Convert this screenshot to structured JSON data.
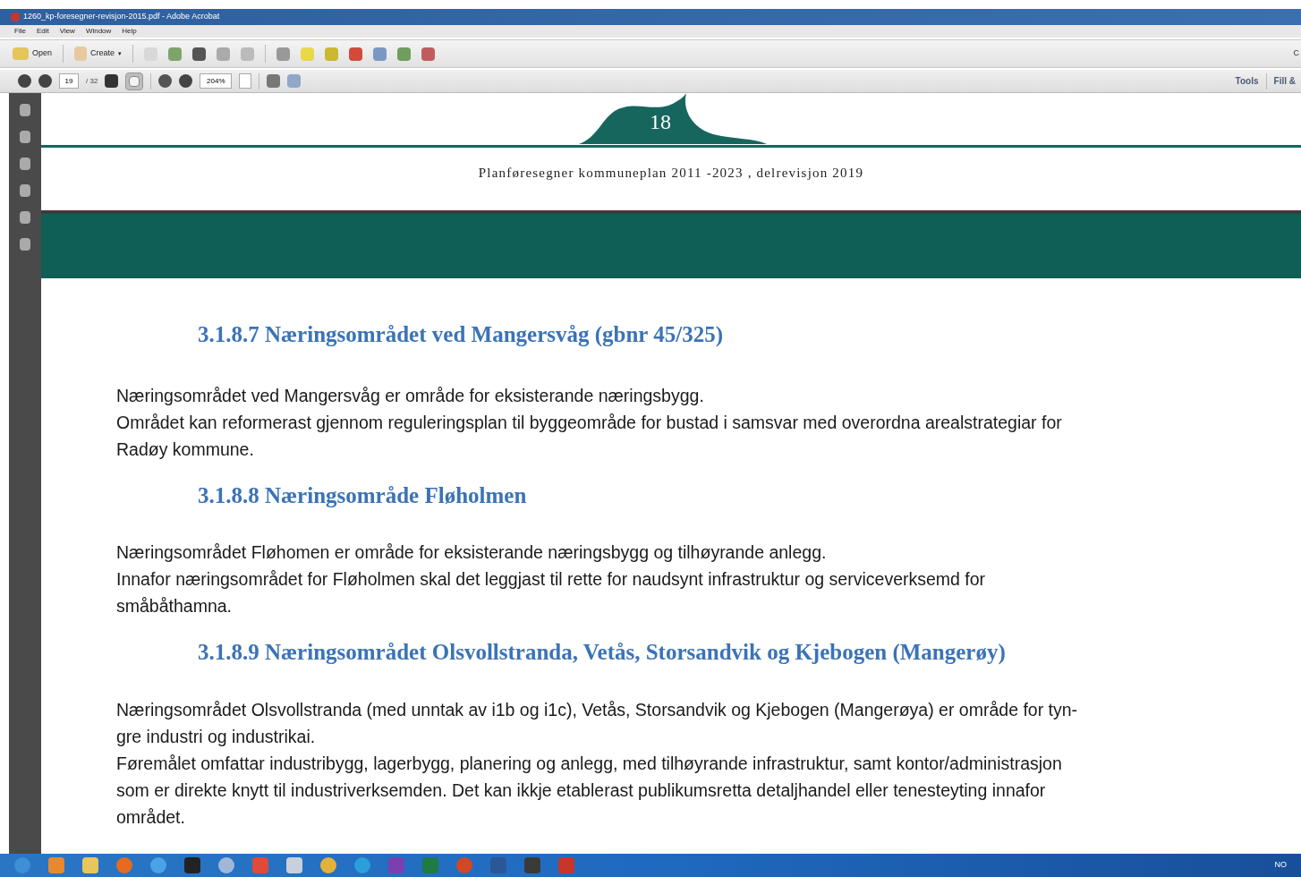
{
  "window": {
    "title": "1260_kp-foresegner-revisjon-2015.pdf - Adobe Acrobat"
  },
  "menu": [
    "File",
    "Edit",
    "View",
    "Window",
    "Help"
  ],
  "toolbar": {
    "open": "Open",
    "create": "Create",
    "create_caret": "▾",
    "right_cut": "C"
  },
  "nav_toolbar": {
    "page": "19",
    "page_count": "/ 32",
    "hand_selected": true,
    "zoom": "204%",
    "tools": "Tools",
    "fill": "Fill &"
  },
  "document": {
    "page_number": "18",
    "running_header": "Planføresegner kommuneplan 2011 -2023 , delrevisjon 2019",
    "sections": [
      {
        "heading": "3.1.8.7 Næringsområdet ved Mangersvåg (gbnr 45/325)",
        "paragraphs": [
          [
            "Næringsområdet ved Mangersvåg er område for eksisterande næringsbygg."
          ],
          [
            "Området kan reformerast gjennom reguleringsplan til byggeområde for bustad i samsvar med overordna arealstrategiar for",
            "Radøy kommune."
          ]
        ]
      },
      {
        "heading": "3.1.8.8 Næringsområde Fløholmen",
        "paragraphs": [
          [
            "Næringsområdet Fløhomen er område for eksisterande næringsbygg og tilhøyrande anlegg."
          ],
          [
            "Innafor næringsområdet for Fløholmen skal det leggjast til rette for naudsynt infrastruktur og serviceverksemd for",
            "småbåthamna."
          ]
        ]
      },
      {
        "heading": "3.1.8.9 Næringsområdet Olsvollstranda, Vetås, Storsandvik og Kjebogen (Mangerøy)",
        "paragraphs": [
          [
            "Næringsområdet Olsvollstranda (med unntak av i1b og i1c), Vetås, Storsandvik og Kjebogen (Mangerøya) er område for tyn-",
            "gre industri og industrikai."
          ],
          [
            "Føremålet omfattar industribygg, lagerbygg, planering og anlegg, med tilhøyrande infrastruktur, samt kontor/administrasjon",
            "som er direkte knytt til industriverksemden. Det kan ikkje etablerast publikumsretta detaljhandel eller tenesteyting innafor",
            "området."
          ]
        ]
      }
    ]
  },
  "taskbar": {
    "language": "NO"
  }
}
